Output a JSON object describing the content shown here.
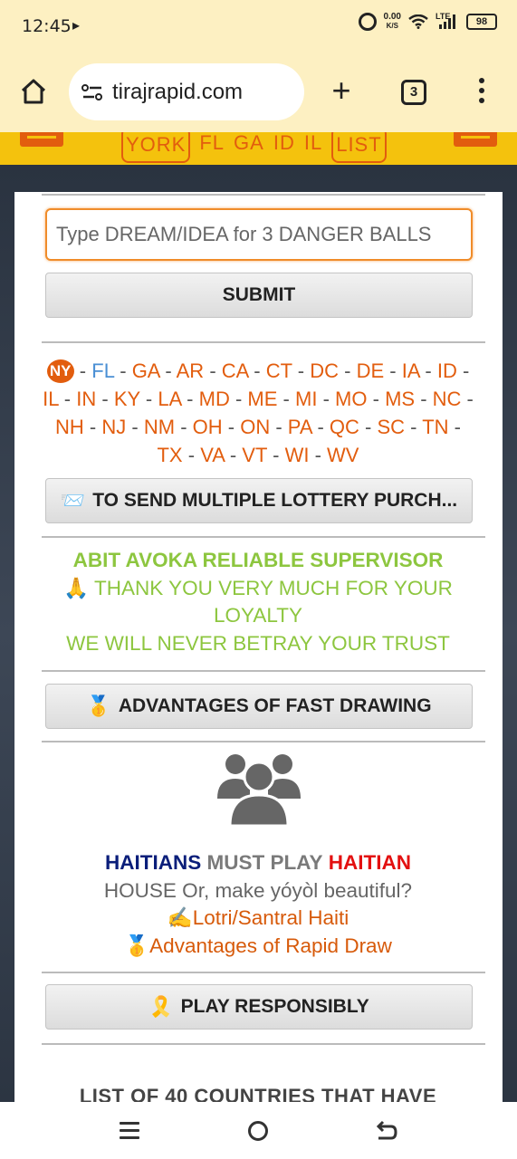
{
  "status": {
    "time": "12:45",
    "media_icon": "play-arrow-icon",
    "speed_value": "0.00",
    "speed_unit": "K/S",
    "network": "LTE",
    "battery": "98"
  },
  "browser": {
    "url": "tirajrapid.com",
    "tab_count": "3"
  },
  "site_header": {
    "states": [
      "YORK",
      "FL",
      "GA",
      "ID",
      "IL",
      "LIST"
    ],
    "accent_color": "#e25d0e",
    "bar_color": "#f4c20d"
  },
  "dream_form": {
    "placeholder": "Type DREAM/IDEA for 3 DANGER BALLS",
    "submit_label": "SUBMIT"
  },
  "states_list": {
    "ny_badge": "NY",
    "fl": "FL",
    "items": [
      "GA",
      "AR",
      "CA",
      "CT",
      "DC",
      "DE",
      "IA",
      "ID",
      "IL",
      "IN",
      "KY",
      "LA",
      "MD",
      "ME",
      "MI",
      "MO",
      "MS",
      "NC",
      "NH",
      "NJ",
      "NM",
      "OH",
      "ON",
      "PA",
      "QC",
      "SC",
      "TN",
      "TX",
      "VA",
      "VT",
      "WI",
      "WV"
    ],
    "separator": "-"
  },
  "buttons": {
    "multiple_purchase": {
      "emoji": "📨",
      "label": "TO SEND MULTIPLE LOTTERY PURCH..."
    },
    "advantages": {
      "emoji": "🥇",
      "label": "ADVANTAGES OF FAST DRAWING"
    },
    "play_responsibly": {
      "emoji": "🎗️",
      "label": "PLAY RESPONSIBLY"
    }
  },
  "supervisor": {
    "title": "ABIT AVOKA RELIABLE SUPERVISOR",
    "thanks_emoji": "🙏",
    "thanks": "THANK YOU VERY MUCH FOR YOUR LOYALTY",
    "promise": "WE WILL NEVER BETRAY YOUR TRUST"
  },
  "haiti": {
    "word_haitians": "HAITIANS",
    "word_must_play": "MUST PLAY",
    "word_haitian": "HAITIAN",
    "line2": "HOUSE Or, make yóyòl beautiful?",
    "link1_emoji": "✍️",
    "link1": "Lotri/Santral Haiti",
    "link2_emoji": "🥇",
    "link2": "Advantages of Rapid Draw"
  },
  "bottom_heading": "LIST OF 40 COUNTRIES THAT HAVE"
}
